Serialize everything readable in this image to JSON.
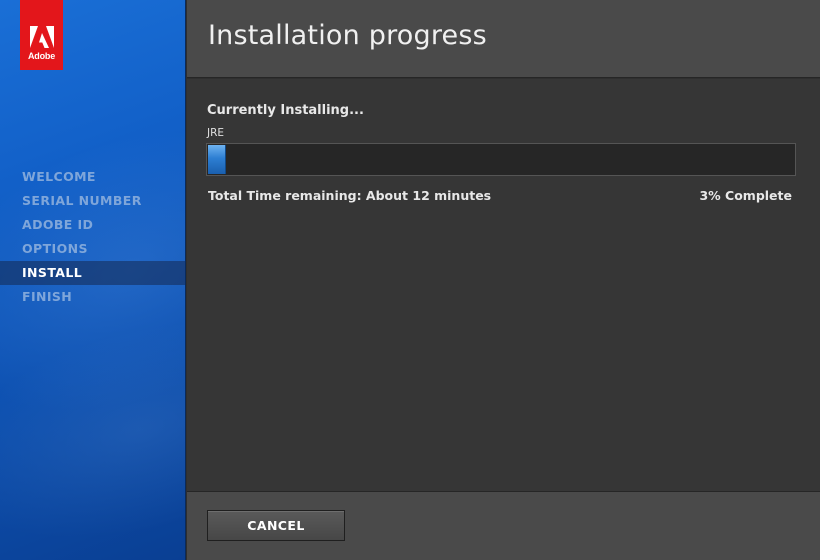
{
  "brand": {
    "logo_text": "Adobe",
    "logo_color": "#e3161b"
  },
  "sidebar": {
    "steps": [
      {
        "label": "WELCOME",
        "active": false
      },
      {
        "label": "SERIAL NUMBER",
        "active": false
      },
      {
        "label": "ADOBE ID",
        "active": false
      },
      {
        "label": "OPTIONS",
        "active": false
      },
      {
        "label": "INSTALL",
        "active": true
      },
      {
        "label": "FINISH",
        "active": false
      }
    ]
  },
  "header": {
    "title": "Installation progress"
  },
  "main": {
    "status_title": "Currently Installing...",
    "component": "JRE",
    "progress_fraction": 0.03,
    "time_remaining": "Total Time remaining: About 12 minutes",
    "percent_label": "3% Complete"
  },
  "footer": {
    "cancel_label": "CANCEL"
  },
  "colors": {
    "accent": "#2d7fd3",
    "sidebar_blue": "#1260c8"
  }
}
